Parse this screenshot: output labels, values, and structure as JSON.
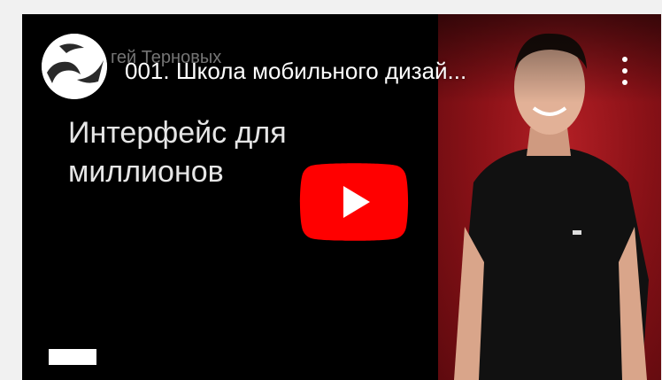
{
  "video": {
    "channel_name": "гей Терновых",
    "title": "001. Школа мобильного дизай...",
    "slide_line_1": "Интерфейс для",
    "slide_line_2": "миллионов"
  },
  "icons": {
    "play": "youtube-play-icon",
    "menu": "more-vert-icon",
    "avatar": "channel-logo"
  },
  "colors": {
    "play_button": "#ff0000",
    "background_right": "#a0161c",
    "page_bg": "#f1f1f1"
  }
}
